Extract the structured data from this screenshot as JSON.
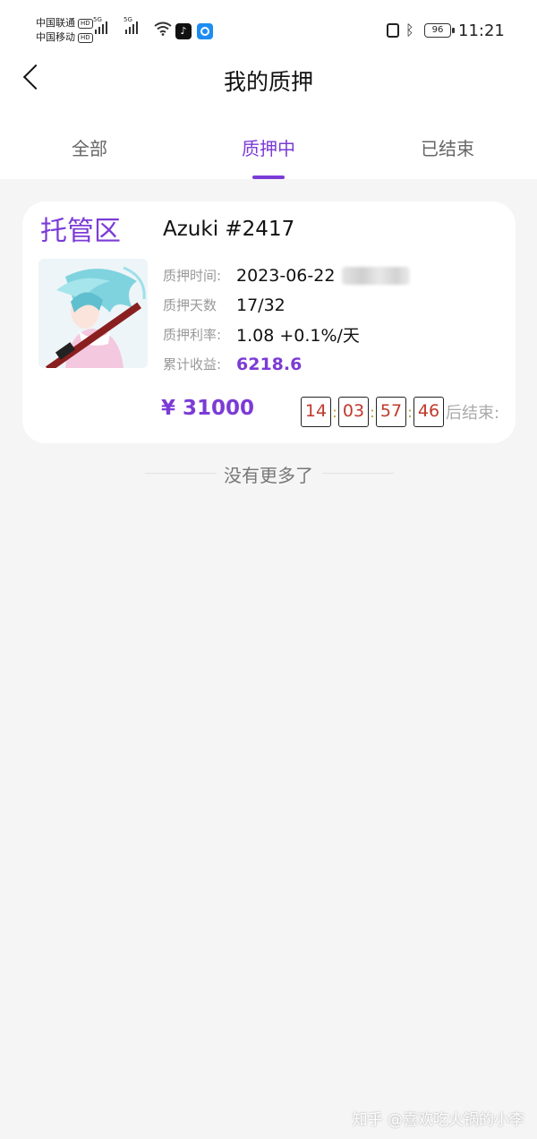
{
  "status_bar": {
    "carrier_1": "中国联通",
    "carrier_2": "中国移动",
    "hd": "HD",
    "net_1": "5G",
    "net_2": "5G",
    "battery": "96",
    "time": "11:21",
    "icons": [
      "wifi-icon",
      "tiktok-icon",
      "app-icon",
      "nfc-icon",
      "bluetooth-icon",
      "battery-icon"
    ]
  },
  "header": {
    "title": "我的质押",
    "back_icon": "chevron-left-icon"
  },
  "tabs": [
    {
      "label": "全部",
      "active": false
    },
    {
      "label": "质押中",
      "active": true
    },
    {
      "label": "已结束",
      "active": false
    }
  ],
  "accent_color": "#7b3bd6",
  "card": {
    "zone": "托管区",
    "title": "Azuki #2417",
    "rows": [
      {
        "label": "质押时间:",
        "value": "2023-06-22"
      },
      {
        "label": "质押天数",
        "value": "17/32"
      },
      {
        "label": "质押利率:",
        "value": "1.08 +0.1%/天"
      },
      {
        "label": "累计收益:",
        "value": "6218.6"
      }
    ],
    "price": "¥ 31000",
    "countdown": {
      "hours": "14",
      "minutes": "03",
      "seconds": "57",
      "centis": "46",
      "separator": ":",
      "suffix": "后结束:"
    }
  },
  "footer": {
    "no_more": "没有更多了"
  },
  "watermark": "知乎 @喜欢吃火锅的小李"
}
